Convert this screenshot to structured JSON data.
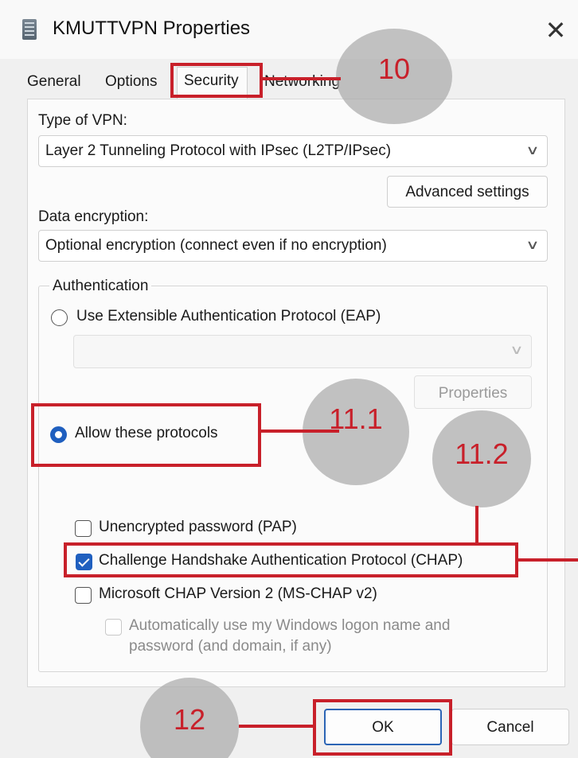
{
  "window": {
    "title": "KMUTTVPN Properties",
    "close_glyph": "✕"
  },
  "tabs": [
    {
      "label": "General"
    },
    {
      "label": "Options"
    },
    {
      "label": "Security",
      "selected": true
    },
    {
      "label": "Networking"
    }
  ],
  "security": {
    "vpn_type_label": "Type of VPN:",
    "vpn_type_value": "Layer 2 Tunneling Protocol with IPsec (L2TP/IPsec)",
    "advanced_settings_label": "Advanced settings",
    "encryption_label": "Data encryption:",
    "encryption_value": "Optional encryption (connect even if no encryption)",
    "authentication": {
      "group_label": "Authentication",
      "eap_label": "Use Extensible Authentication Protocol (EAP)",
      "eap_selected": false,
      "eap_dropdown_value": "",
      "eap_properties_label": "Properties",
      "allow_protocols_label": "Allow these protocols",
      "allow_protocols_selected": true,
      "protocols": [
        {
          "label": "Unencrypted password (PAP)",
          "checked": false
        },
        {
          "label": "Challenge Handshake Authentication Protocol (CHAP)",
          "checked": true
        },
        {
          "label": "Microsoft CHAP Version 2 (MS-CHAP v2)",
          "checked": false
        }
      ],
      "auto_logon_line1": "Automatically use my Windows logon name and",
      "auto_logon_line2": "password (and domain, if any)",
      "auto_logon_checked": false
    }
  },
  "footer": {
    "ok_label": "OK",
    "cancel_label": "Cancel"
  },
  "annotations": {
    "step_10": "10",
    "step_11_1": "11.1",
    "step_11_2": "11.2",
    "step_12": "12",
    "color": "#c8202a"
  }
}
